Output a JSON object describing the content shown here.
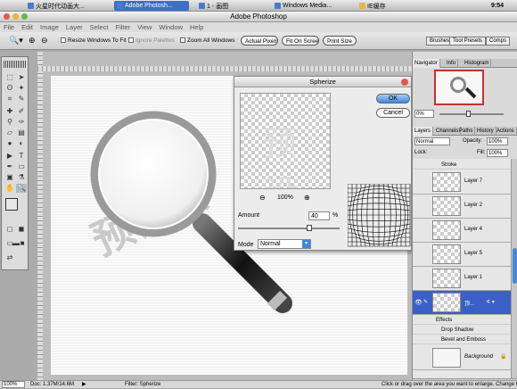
{
  "taskbar": {
    "app1": "火星时代动画大...",
    "app2": "Adobe Photosh...",
    "app3": "1 - 画图",
    "app4": "Windows Media...",
    "app5": "IE缓存",
    "time": "9:54"
  },
  "window": {
    "title": "Adobe Photoshop"
  },
  "menu": [
    "File",
    "Edit",
    "Image",
    "Layer",
    "Select",
    "Filter",
    "View",
    "Window",
    "Help"
  ],
  "options": {
    "resize": "Resize Windows To Fit",
    "ignore": "Ignore Palettes",
    "zoomall": "Zoom All Windows",
    "actual": "Actual Pixels",
    "fit": "Fit On Screen",
    "print": "Print Size",
    "brushes": "Brushes",
    "toolpresets": "Tool Presets",
    "comps": "Comps"
  },
  "canvas": {
    "text": "预设去"
  },
  "dialog": {
    "title": "Spherize",
    "ok": "OK",
    "cancel": "Cancel",
    "zoom": "100%",
    "amount_label": "Amount",
    "amount_value": "40",
    "amount_unit": "%",
    "amount_percent": 0.7,
    "mode_label": "Mode",
    "mode_value": "Normal"
  },
  "navigator": {
    "tabs": [
      "Navigator",
      "Info",
      "Histogram"
    ],
    "zoom": "0%"
  },
  "layers": {
    "tabs": [
      "Layers",
      "Channels",
      "Paths",
      "History",
      "Actions"
    ],
    "blend": "Normal",
    "opacity_label": "Opacity:",
    "opacity": "100%",
    "lock_label": "Lock:",
    "fill_label": "Fill:",
    "fill": "100%",
    "stroke": "Stroke",
    "items": [
      "Layer 7",
      "Layer 2",
      "Layer 4",
      "Layer 5",
      "Layer 1"
    ],
    "selected": "顶...",
    "effects": "Effects",
    "drop_shadow": "Drop Shadow",
    "bevel": "Bevel and Emboss",
    "background": "Background"
  },
  "status": {
    "zoom": "100%",
    "doc": "Doc: 1.37M/14.6M",
    "filter": "Filter: Spherize",
    "hint": "Click or drag over the area you want to enlarge. Change t"
  },
  "colors": {
    "selection": "#3a5fc8",
    "accent": "#3f86df"
  }
}
